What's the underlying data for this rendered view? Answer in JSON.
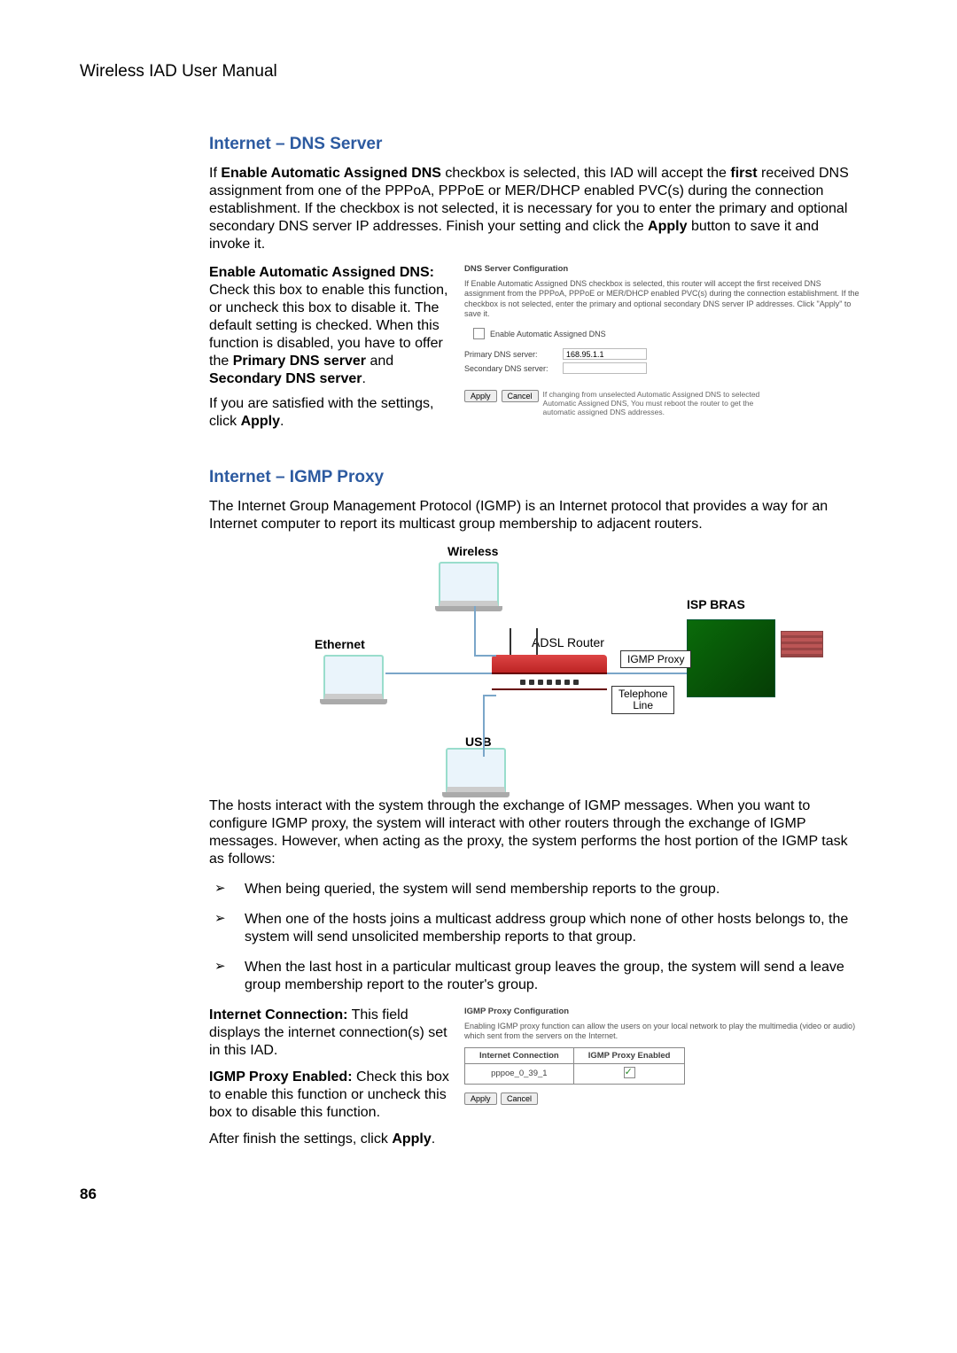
{
  "header": {
    "title": "Wireless IAD User Manual"
  },
  "page_number": "86",
  "dns": {
    "heading": "Internet – DNS Server",
    "intro_prefix": "If ",
    "intro_bold1": "Enable Automatic Assigned DNS",
    "intro_mid1": " checkbox is selected, this IAD will accept the ",
    "intro_bold2": "first",
    "intro_mid2": " received DNS assignment from one of the PPPoA, PPPoE or MER/DHCP enabled PVC(s) during the connection establishment. If the checkbox is not selected, it is necessary for you to enter the primary and optional secondary DNS server IP addresses. Finish your setting and click the ",
    "intro_bold3": "Apply",
    "intro_end": " button to save it and invoke it.",
    "left_bold1": "Enable Automatic Assigned DNS:",
    "left_text1": " Check this box to enable this function, or uncheck this box to disable it. The default setting is checked. When this function is disabled, you have to offer the ",
    "left_bold2": "Primary DNS server",
    "left_and": " and ",
    "left_bold3": "Secondary DNS server",
    "left_period": ".",
    "left_satisfied": "If you are satisfied with the settings, click ",
    "left_apply": "Apply",
    "screenshot": {
      "title": "DNS Server Configuration",
      "desc": "If Enable Automatic Assigned DNS checkbox is selected, this router will accept the first received DNS assignment from the PPPoA, PPPoE or MER/DHCP enabled PVC(s) during the connection establishment. If the checkbox is not selected, enter the primary and optional secondary DNS server IP addresses. Click \"Apply\" to save it.",
      "checkbox_label": "Enable Automatic Assigned DNS",
      "primary_label": "Primary DNS server:",
      "primary_value": "168.95.1.1",
      "secondary_label": "Secondary DNS server:",
      "secondary_value": "",
      "apply": "Apply",
      "cancel": "Cancel",
      "note": "If changing from unselected Automatic Assigned DNS to selected Automatic Assigned DNS, You must reboot the router to get the automatic assigned DNS addresses."
    }
  },
  "igmp": {
    "heading": "Internet – IGMP Proxy",
    "intro": "The Internet Group Management Protocol (IGMP) is an Internet protocol that provides a way for an Internet computer to report its multicast group membership to adjacent routers.",
    "diagram": {
      "wireless": "Wireless",
      "ethernet": "Ethernet",
      "usb": "USB",
      "adsl_router": "ADSL Router",
      "isp_bras": "ISP BRAS",
      "igmp_proxy": "IGMP   Proxy",
      "telephone_line_a": "Telephone",
      "telephone_line_b": "Line"
    },
    "hosts_para": "The hosts interact with the system through the exchange of IGMP messages. When you want to configure IGMP proxy, the system will interact with other routers through the exchange of IGMP messages. However, when acting as the proxy, the system performs the host portion of the IGMP task as follows:",
    "bullets": [
      "When being queried, the system will send membership reports to the group.",
      "When one of the hosts joins a multicast address group which none of other hosts belongs to, the system will send unsolicited membership reports to that group.",
      "When the last host in a particular multicast group leaves the group, the system will send a leave group membership report to the router's group."
    ],
    "conn_bold": "Internet Connection:",
    "conn_text": " This field displays the internet connection(s) set in this IAD.",
    "enabled_bold": "IGMP Proxy Enabled:",
    "enabled_text": " Check this box to enable this function or uncheck this box to disable this function.",
    "after_prefix": "After finish the settings, click ",
    "after_bold": "Apply",
    "after_suffix": ".",
    "screenshot": {
      "title": "IGMP Proxy Configuration",
      "desc": "Enabling IGMP proxy function can allow the users on your local network to play the multimedia (video or audio) which sent from the servers on the Internet.",
      "col1": "Internet Connection",
      "col2": "IGMP Proxy Enabled",
      "row_conn": "pppoe_0_39_1",
      "apply": "Apply",
      "cancel": "Cancel"
    }
  }
}
